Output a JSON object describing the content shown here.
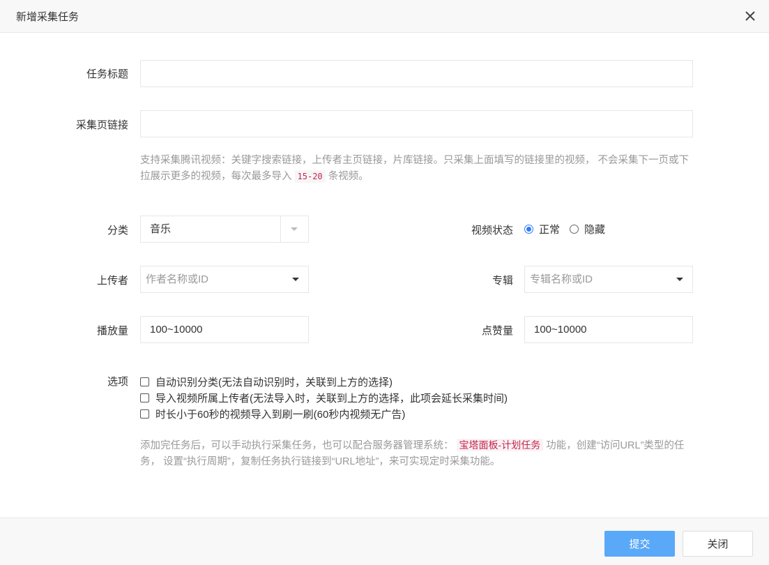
{
  "dialog": {
    "title": "新增采集任务",
    "close_icon": "close-icon"
  },
  "form": {
    "task_title": {
      "label": "任务标题",
      "value": ""
    },
    "collect_url": {
      "label": "采集页链接",
      "value": "",
      "help_part1": "支持采集腾讯视频：关键字搜索链接，上传者主页链接，片库链接。只采集上面填写的链接里的视频， 不会采集下一页或下拉展示更多的视频，每次最多导入",
      "help_code": "15-20",
      "help_part2": "条视频。"
    },
    "category": {
      "label": "分类",
      "selected": "音乐"
    },
    "video_status": {
      "label": "视频状态",
      "options": [
        {
          "label": "正常",
          "checked": true
        },
        {
          "label": "隐藏",
          "checked": false
        }
      ]
    },
    "uploader": {
      "label": "上传者",
      "placeholder": "作者名称或ID"
    },
    "album": {
      "label": "专辑",
      "placeholder": "专辑名称或ID"
    },
    "play_count": {
      "label": "播放量",
      "value": "100~10000"
    },
    "like_count": {
      "label": "点赞量",
      "value": "100~10000"
    },
    "options": {
      "label": "选项",
      "items": [
        {
          "label": "自动识别分类(无法自动识别时，关联到上方的选择)",
          "checked": false
        },
        {
          "label": "导入视频所属上传者(无法导入时，关联到上方的选择，此项会延长采集时间)",
          "checked": false
        },
        {
          "label": "时长小于60秒的视频导入到刷一刷(60秒内视频无广告)",
          "checked": false
        }
      ]
    },
    "bottom_help": {
      "part1": "添加完任务后，可以手动执行采集任务，也可以配合服务器管理系统：",
      "code": "宝塔面板-计划任务",
      "part2": "功能，创建“访问URL”类型的任务， 设置“执行周期”，复制任务执行链接到“URL地址”，来可实现定时采集功能。"
    }
  },
  "footer": {
    "submit_label": "提交",
    "close_label": "关闭"
  },
  "colors": {
    "primary": "#5aa8f8",
    "radio_active": "#2e7cf6",
    "code_text": "#c7254e"
  }
}
